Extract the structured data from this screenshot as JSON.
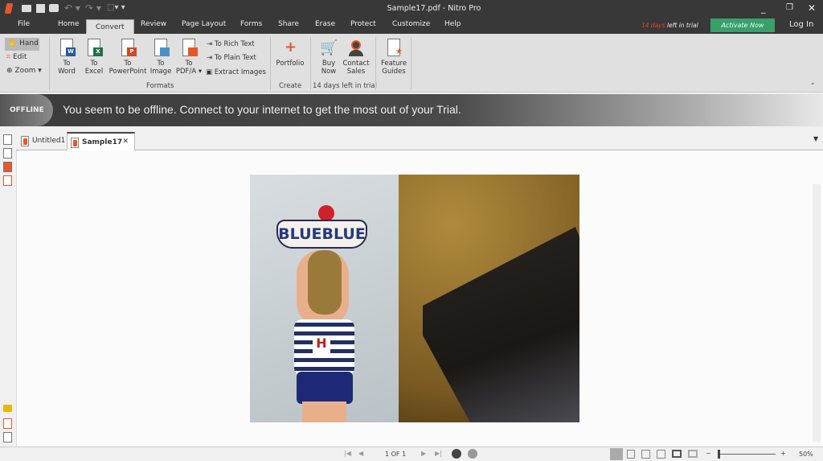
{
  "window": {
    "title": "Sample17.pdf - Nitro Pro"
  },
  "menu": {
    "tabs": [
      "File",
      "Home",
      "Convert",
      "Review",
      "Page Layout",
      "Forms",
      "Share",
      "Erase",
      "Protect",
      "Customize",
      "Help"
    ],
    "active": "Convert",
    "trial_days": "14 days",
    "trial_rest": "left in trial",
    "activate": "Activate Now",
    "login": "Log In"
  },
  "ribbon": {
    "tools": {
      "hand": "Hand",
      "edit": "Edit",
      "zoom": "Zoom"
    },
    "formats": {
      "items": [
        {
          "l1": "To",
          "l2": "Word",
          "badge": "W",
          "color": "#2b579a"
        },
        {
          "l1": "To",
          "l2": "Excel",
          "badge": "X",
          "color": "#217346"
        },
        {
          "l1": "To",
          "l2": "PowerPoint",
          "badge": "P",
          "color": "#d24726"
        },
        {
          "l1": "To",
          "l2": "Image",
          "badge": "",
          "color": "#4a90c8"
        },
        {
          "l1": "To",
          "l2": "PDF/A",
          "badge": "",
          "color": "#e8562a"
        }
      ],
      "rich": "To Rich Text",
      "plain": "To Plain Text",
      "extract": "Extract Images",
      "label": "Formats"
    },
    "create": {
      "portfolio": "Portfolio",
      "label": "Create"
    },
    "trial": {
      "buy1": "Buy",
      "buy2": "Now",
      "contact1": "Contact",
      "contact2": "Sales",
      "label": "14 days left in trial"
    },
    "guides": {
      "l1": "Feature",
      "l2": "Guides"
    }
  },
  "offline": {
    "badge": "OFFLINE",
    "message": "You seem to be offline. Connect to your internet to get the most out of your Trial."
  },
  "doc_tabs": [
    {
      "label": "Untitled1"
    },
    {
      "label": "Sample17",
      "active": true
    }
  ],
  "page_image": {
    "sign_text": "BLUEBLUE",
    "shirt_letter": "H"
  },
  "status": {
    "page": "1 OF 1",
    "zoom": "50%",
    "zoom_level": 0.5
  },
  "colors": {
    "accent": "#e8562a",
    "activate": "#3aa06a",
    "titlebar": "#383838"
  }
}
